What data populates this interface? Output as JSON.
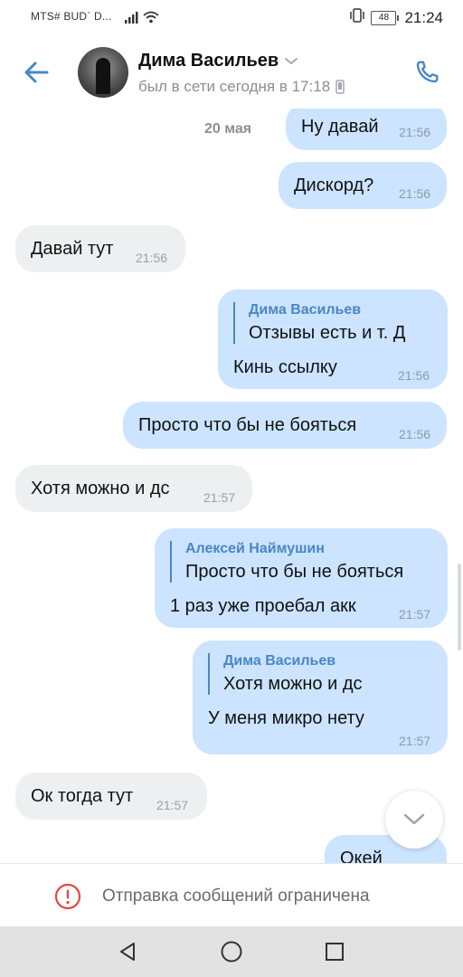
{
  "status_bar": {
    "carrier": "MTS# BUD` D...",
    "battery": "48",
    "time": "21:24"
  },
  "header": {
    "name": "Дима Васильев",
    "status": "был в сети сегодня в 17:18"
  },
  "chat": {
    "date_label": "20 мая",
    "messages": [
      {
        "dir": "out",
        "text": "Ну давай",
        "time": "21:56"
      },
      {
        "dir": "out",
        "text": "Дискорд?",
        "time": "21:56"
      },
      {
        "dir": "in",
        "text": "Давай тут",
        "time": "21:56"
      },
      {
        "dir": "out",
        "reply_name": "Дима Васильев",
        "reply_text": "Отзывы есть и т. Д",
        "text": "Кинь ссылку",
        "time": "21:56"
      },
      {
        "dir": "out",
        "text": "Просто что бы не бояться",
        "time": "21:56"
      },
      {
        "dir": "in",
        "text": "Хотя можно и дс",
        "time": "21:57"
      },
      {
        "dir": "out",
        "reply_name": "Алексей Наймушин",
        "reply_text": "Просто что бы не бояться",
        "text": "1 раз уже проебал акк",
        "time": "21:57"
      },
      {
        "dir": "out",
        "reply_name": "Дима Васильев",
        "reply_text": "Хотя можно и дс",
        "text": "У меня микро нету",
        "time": "21:57"
      },
      {
        "dir": "in",
        "text": "Ок тогда тут",
        "time": "21:57"
      },
      {
        "dir": "out",
        "text": "Окей",
        "time": ""
      }
    ]
  },
  "restriction": {
    "text": "Отправка сообщений ограничена"
  },
  "colors": {
    "accent": "#4a86c5",
    "outgoing_bubble": "#cce4ff",
    "incoming_bubble": "#eeeff1",
    "warning": "#e64646"
  },
  "icons": {
    "back": "arrow-left-icon",
    "phone": "phone-icon",
    "dropdown": "chevron-down-icon",
    "device": "mobile-device-icon",
    "scroll_down": "chevron-down-icon",
    "warning": "exclamation-circle-icon",
    "nav_back": "triangle-back-icon",
    "nav_home": "circle-home-icon",
    "nav_recents": "square-recents-icon"
  }
}
